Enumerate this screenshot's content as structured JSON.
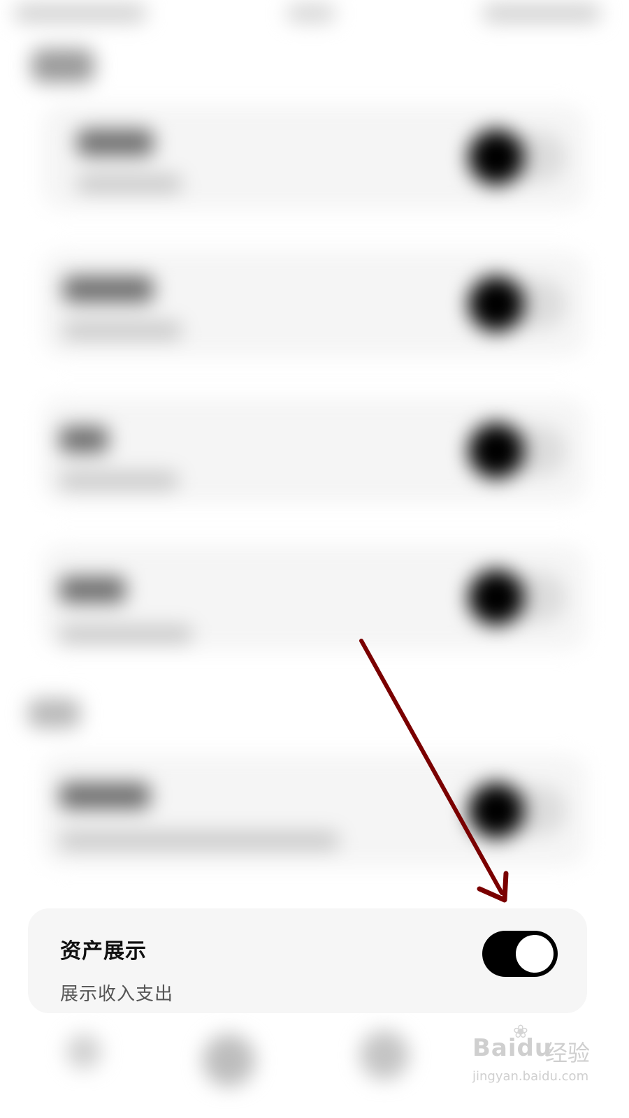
{
  "setting": {
    "title": "资产展示",
    "description": "展示收入支出",
    "enabled": true
  },
  "watermark": {
    "brand": "Baidu",
    "product": "经验",
    "url": "jingyan.baidu.com"
  },
  "colors": {
    "arrow": "#7a0000",
    "toggle_on": "#000000",
    "card_bg": "#f6f6f6"
  }
}
